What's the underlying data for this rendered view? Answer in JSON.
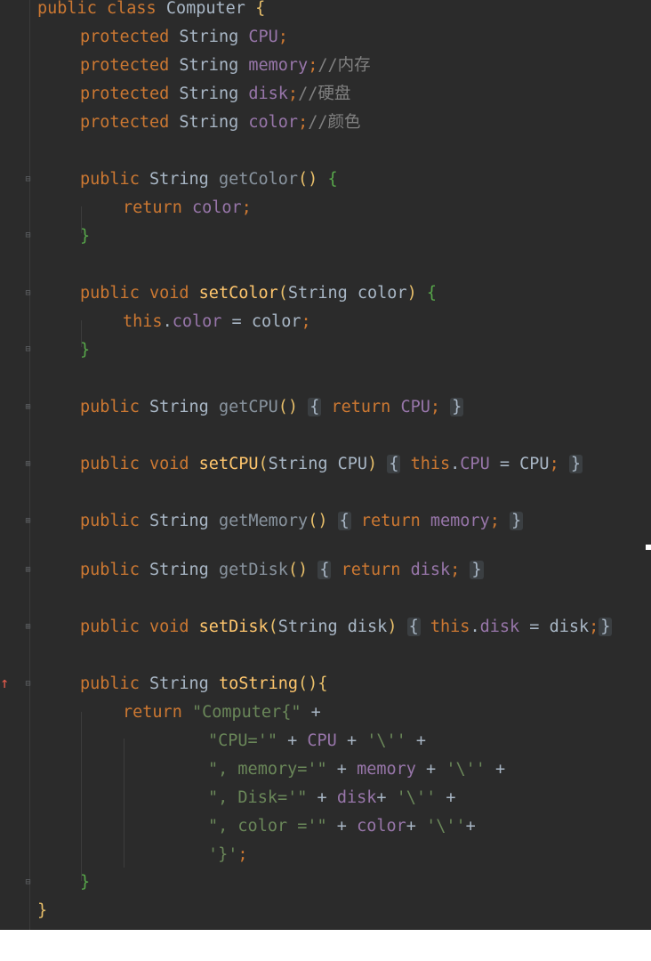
{
  "code": {
    "class_decl": {
      "public": "public",
      "class": "class",
      "name": "Computer",
      "brace": "{"
    },
    "fields": [
      {
        "modifier": "protected",
        "type": "String",
        "name": "CPU",
        "semicolon": ";",
        "comment": ""
      },
      {
        "modifier": "protected",
        "type": "String",
        "name": "memory",
        "semicolon": ";",
        "comment": "//内存"
      },
      {
        "modifier": "protected",
        "type": "String",
        "name": "disk",
        "semicolon": ";",
        "comment": "//硬盘"
      },
      {
        "modifier": "protected",
        "type": "String",
        "name": "color",
        "semicolon": ";",
        "comment": "//颜色"
      }
    ],
    "getColor": {
      "public": "public",
      "type": "String",
      "name": "getColor",
      "parens": "()",
      "brace": "{",
      "return": "return",
      "field": "color",
      "semicolon": ";",
      "close": "}"
    },
    "setColor": {
      "public": "public",
      "void": "void",
      "name": "setColor",
      "open_paren": "(",
      "param_type": "String",
      "param_name": "color",
      "close_paren": ")",
      "brace": "{",
      "this": "this",
      "dot": ".",
      "field": "color",
      "assign": " = ",
      "value": "color",
      "semicolon": ";",
      "close": "}"
    },
    "getCPU": {
      "public": "public",
      "type": "String",
      "name": "getCPU",
      "parens": "()",
      "open": "{",
      "return": "return",
      "field": "CPU",
      "semicolon": ";",
      "close": "}"
    },
    "setCPU": {
      "public": "public",
      "void": "void",
      "name": "setCPU",
      "open_paren": "(",
      "param": "String CPU",
      "close_paren": ")",
      "open": "{",
      "this": "this",
      "dot": ".",
      "field": "CPU",
      "assign": " = ",
      "value": "CPU",
      "semicolon": ";",
      "close": "}"
    },
    "getMemory": {
      "public": "public",
      "type": "String",
      "name": "getMemory",
      "parens": "()",
      "open": "{",
      "return": "return",
      "field": "memory",
      "semicolon": ";",
      "close": "}"
    },
    "getDisk": {
      "public": "public",
      "type": "String",
      "name": "getDisk",
      "parens": "()",
      "open": "{",
      "return": "return",
      "field": "disk",
      "semicolon": ";",
      "close": "}"
    },
    "setDisk": {
      "public": "public",
      "void": "void",
      "name": "setDisk",
      "open_paren": "(",
      "param": "String disk",
      "close_paren": ")",
      "open": "{",
      "this": "this",
      "dot": ".",
      "field": "disk",
      "assign": " = ",
      "value": "disk",
      "semicolon": ";",
      "close": "}"
    },
    "toString": {
      "public": "public",
      "type": "String",
      "name": "toString",
      "parens": "()",
      "brace": "{",
      "return": "return",
      "l1_str": "\"Computer{\"",
      "plus": " +",
      "l2_str": "\"CPU='\"",
      "l2_mid": " + ",
      "l2_field": "CPU",
      "l2_mid2": " + ",
      "l2_char": "'\\''",
      "l2_end": " +",
      "l3_str": "\", memory='\"",
      "l3_mid": " + ",
      "l3_field": "memory",
      "l3_mid2": " + ",
      "l3_char": "'\\''",
      "l3_end": " +",
      "l4_str": "\", Disk='\"",
      "l4_mid": " + ",
      "l4_field": "disk",
      "l4_mid2": "+ ",
      "l4_char": "'\\''",
      "l4_end": " +",
      "l5_str": "\", color ='\"",
      "l5_mid": " + ",
      "l5_field": "color",
      "l5_mid2": "+ ",
      "l5_char": "'\\''",
      "l5_end": "+",
      "l6_char": "'}'",
      "l6_end": ";",
      "close": "}"
    },
    "class_close": "}"
  },
  "gutter": {
    "fold_icon": "fold-icon",
    "expand_icon": "expand-icon",
    "override_icon": "override-arrow-icon",
    "fold_glyph": "⊟",
    "expand_glyph": "⊞",
    "override_glyph": "↑"
  },
  "colors": {
    "background": "#2b2b2b",
    "keyword": "#cc7832",
    "field": "#9876aa",
    "method": "#ffc66d",
    "string": "#6a8759",
    "comment": "#808080",
    "text": "#a9b7c6"
  }
}
